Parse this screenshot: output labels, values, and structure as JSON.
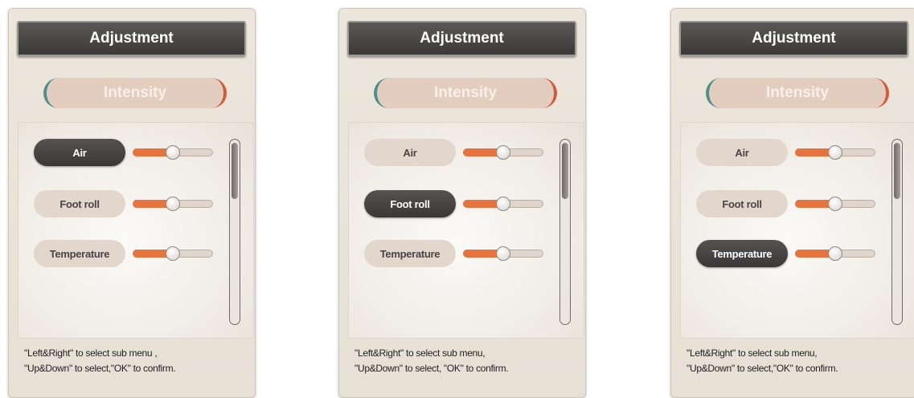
{
  "panels": [
    {
      "title": "Adjustment",
      "tab": "Intensity",
      "items": [
        {
          "label": "Air",
          "level": 0.5
        },
        {
          "label": "Foot roll",
          "level": 0.5
        },
        {
          "label": "Temperature",
          "level": 0.5
        }
      ],
      "selected": "Air",
      "help_line1": "\"Left&Right\" to select sub menu ,",
      "help_line2": "\"Up&Down\" to select,\"OK\" to confirm."
    },
    {
      "title": "Adjustment",
      "tab": "Intensity",
      "items": [
        {
          "label": "Air",
          "level": 0.5
        },
        {
          "label": "Foot roll",
          "level": 0.5
        },
        {
          "label": "Temperature",
          "level": 0.5
        }
      ],
      "selected": "Foot roll",
      "help_line1": "\"Left&Right\" to select sub menu,",
      "help_line2": "\"Up&Down\" to select, \"OK\" to confirm."
    },
    {
      "title": "Adjustment",
      "tab": "Intensity",
      "items": [
        {
          "label": "Air",
          "level": 0.5
        },
        {
          "label": "Foot roll",
          "level": 0.5
        },
        {
          "label": "Temperature",
          "level": 0.5
        }
      ],
      "selected": "Temperature",
      "help_line1": "\"Left&Right\" to select sub menu,",
      "help_line2": "\"Up&Down\" to select,\"OK\" to confirm."
    }
  ],
  "colors": {
    "accent_orange": "#e8743d",
    "selected_dark": "#3c3a39",
    "pill_light": "#e3d6cc",
    "intensity_bg": "#e3cdbf"
  }
}
